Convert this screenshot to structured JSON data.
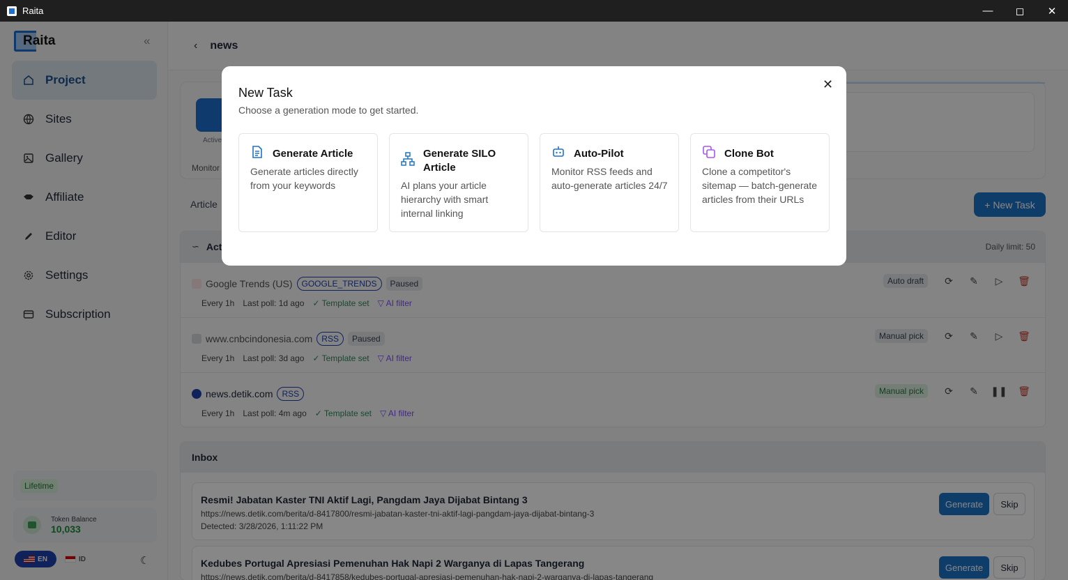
{
  "window": {
    "title": "Raita"
  },
  "sidebar": {
    "brand": "Raita",
    "items": [
      {
        "label": "Project"
      },
      {
        "label": "Sites"
      },
      {
        "label": "Gallery"
      },
      {
        "label": "Affiliate"
      },
      {
        "label": "Editor"
      },
      {
        "label": "Settings"
      },
      {
        "label": "Subscription"
      }
    ],
    "plan": "Lifetime",
    "token_label": "Token Balance",
    "token_value": "10,033",
    "lang_en": "EN",
    "lang_id": "ID"
  },
  "header": {
    "title": "news"
  },
  "project": {
    "active_label": "Active",
    "monitor_label": "Monitor",
    "articles_tab": "Article",
    "new_task": "+ New Task"
  },
  "feeds": {
    "title": "Act",
    "daily_limit": "Daily limit: 50",
    "rows": [
      {
        "name": "Google Trends (US)",
        "type": "GOOGLE_TRENDS",
        "status": "Paused",
        "interval": "Every 1h",
        "last_poll": "Last poll: 1d ago",
        "template": "Template set",
        "filter": "AI filter",
        "mode": "Auto draft"
      },
      {
        "name": "www.cnbcindonesia.com",
        "type": "RSS",
        "status": "Paused",
        "interval": "Every 1h",
        "last_poll": "Last poll: 3d ago",
        "template": "Template set",
        "filter": "AI filter",
        "mode": "Manual pick"
      },
      {
        "name": "news.detik.com",
        "type": "RSS",
        "status": "",
        "interval": "Every 1h",
        "last_poll": "Last poll: 4m ago",
        "template": "Template set",
        "filter": "AI filter",
        "mode": "Manual pick"
      }
    ]
  },
  "inbox": {
    "title": "Inbox",
    "generate": "Generate",
    "skip": "Skip",
    "items": [
      {
        "headline": "Resmi! Jabatan Kaster TNI Aktif Lagi, Pangdam Jaya Dijabat Bintang 3",
        "url": "https://news.detik.com/berita/d-8417800/resmi-jabatan-kaster-tni-aktif-lagi-pangdam-jaya-dijabat-bintang-3",
        "detected": "Detected: 3/28/2026, 1:11:22 PM"
      },
      {
        "headline": "Kedubes Portugal Apresiasi Pemenuhan Hak Napi 2 Warganya di Lapas Tangerang",
        "url": "https://news.detik.com/berita/d-8417858/kedubes-portugal-apresiasi-pemenuhan-hak-napi-2-warganya-di-lapas-tangerang",
        "detected": ""
      }
    ]
  },
  "modal": {
    "title": "New Task",
    "subtitle": "Choose a generation mode to get started.",
    "options": [
      {
        "name": "Generate Article",
        "desc": "Generate articles directly from your keywords",
        "icon": "document-icon",
        "color": "#1e73c8"
      },
      {
        "name": "Generate SILO Article",
        "desc": "AI plans your article hierarchy with smart internal linking",
        "icon": "hierarchy-icon",
        "color": "#1e73c8"
      },
      {
        "name": "Auto-Pilot",
        "desc": "Monitor RSS feeds and auto-generate articles 24/7",
        "icon": "robot-icon",
        "color": "#1e73c8"
      },
      {
        "name": "Clone Bot",
        "desc": "Clone a competitor's sitemap — batch-generate articles from their URLs",
        "icon": "copy-icon",
        "color": "#a855f7"
      }
    ]
  }
}
